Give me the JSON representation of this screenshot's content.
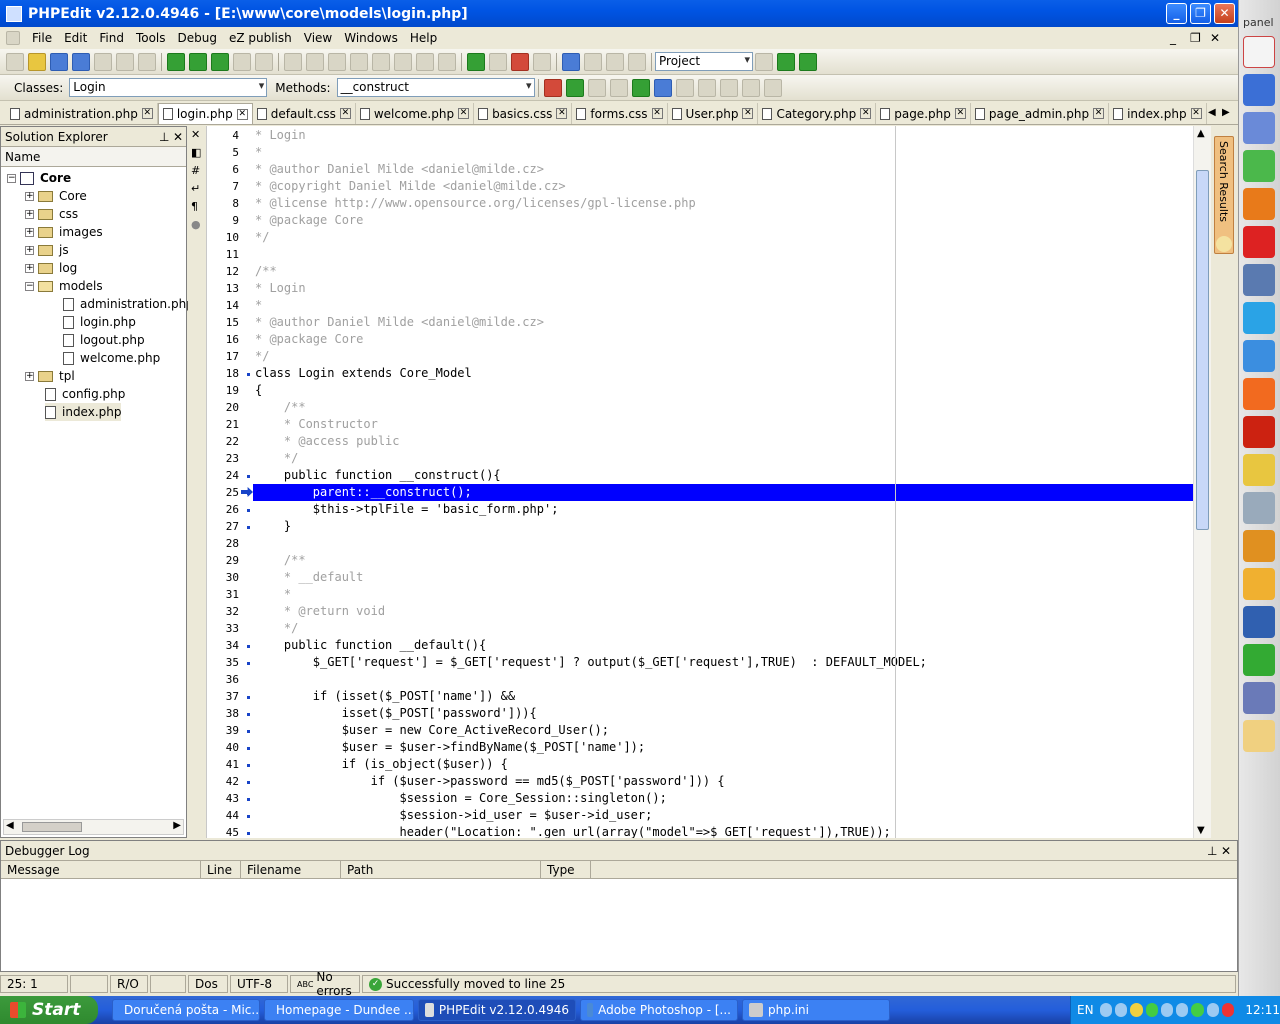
{
  "window": {
    "title": "PHPEdit v2.12.0.4946 - [E:\\www\\core\\models\\login.php]"
  },
  "menu": [
    "File",
    "Edit",
    "Find",
    "Tools",
    "Debug",
    "eZ publish",
    "View",
    "Windows",
    "Help"
  ],
  "toolbar": {
    "project_combo": "Project"
  },
  "toolbar2": {
    "classes_label": "Classes:",
    "classes_value": "Login",
    "methods_label": "Methods:",
    "methods_value": "__construct"
  },
  "tabs": [
    "administration.php",
    "login.php",
    "default.css",
    "welcome.php",
    "basics.css",
    "forms.css",
    "User.php",
    "Category.php",
    "page.php",
    "page_admin.php",
    "index.php"
  ],
  "solution": {
    "title": "Solution Explorer",
    "col": "Name",
    "root": "Core",
    "nodes": [
      {
        "label": "Core",
        "kind": "folder"
      },
      {
        "label": "css",
        "kind": "folder"
      },
      {
        "label": "images",
        "kind": "folder"
      },
      {
        "label": "js",
        "kind": "folder"
      },
      {
        "label": "log",
        "kind": "folder"
      },
      {
        "label": "models",
        "kind": "folder-open"
      },
      {
        "label": "administration.php",
        "kind": "file"
      },
      {
        "label": "login.php",
        "kind": "file"
      },
      {
        "label": "logout.php",
        "kind": "file"
      },
      {
        "label": "welcome.php",
        "kind": "file"
      },
      {
        "label": "tpl",
        "kind": "folder"
      },
      {
        "label": "config.php",
        "kind": "file"
      },
      {
        "label": "index.php",
        "kind": "file"
      }
    ]
  },
  "code": {
    "lines": [
      {
        "n": "4",
        "t": "* Login",
        "c": "comment"
      },
      {
        "n": "5",
        "t": "*",
        "c": "comment"
      },
      {
        "n": "6",
        "t": "* @author Daniel Milde <daniel@milde.cz>",
        "c": "comment"
      },
      {
        "n": "7",
        "t": "* @copyright Daniel Milde <daniel@milde.cz>",
        "c": "comment"
      },
      {
        "n": "8",
        "t": "* @license http://www.opensource.org/licenses/gpl-license.php",
        "c": "comment"
      },
      {
        "n": "9",
        "t": "* @package Core",
        "c": "comment"
      },
      {
        "n": "10",
        "t": "*/",
        "c": "comment"
      },
      {
        "n": "11",
        "t": "",
        "c": ""
      },
      {
        "n": "12",
        "t": "/**",
        "c": "comment"
      },
      {
        "n": "13",
        "t": "* Login",
        "c": "comment"
      },
      {
        "n": "14",
        "t": "*",
        "c": "comment"
      },
      {
        "n": "15",
        "t": "* @author Daniel Milde <daniel@milde.cz>",
        "c": "comment"
      },
      {
        "n": "16",
        "t": "* @package Core",
        "c": "comment"
      },
      {
        "n": "17",
        "t": "*/",
        "c": "comment"
      },
      {
        "n": "18",
        "t": "class Login extends Core_Model",
        "c": "kw"
      },
      {
        "n": "19",
        "t": "{",
        "c": ""
      },
      {
        "n": "20",
        "t": "    /**",
        "c": "comment"
      },
      {
        "n": "21",
        "t": "    * Constructor",
        "c": "comment"
      },
      {
        "n": "22",
        "t": "    * @access public",
        "c": "comment"
      },
      {
        "n": "23",
        "t": "    */",
        "c": "comment"
      },
      {
        "n": "24",
        "t": "    public function __construct(){",
        "c": "kw"
      },
      {
        "n": "25",
        "t": "        parent::__construct();",
        "c": "hl"
      },
      {
        "n": "26",
        "t": "        $this->tplFile = 'basic_form.php';",
        "c": "var"
      },
      {
        "n": "27",
        "t": "    }",
        "c": ""
      },
      {
        "n": "28",
        "t": "",
        "c": ""
      },
      {
        "n": "29",
        "t": "    /**",
        "c": "comment"
      },
      {
        "n": "30",
        "t": "    * __default",
        "c": "comment"
      },
      {
        "n": "31",
        "t": "    *",
        "c": "comment"
      },
      {
        "n": "32",
        "t": "    * @return void",
        "c": "comment"
      },
      {
        "n": "33",
        "t": "    */",
        "c": "comment"
      },
      {
        "n": "34",
        "t": "    public function __default(){",
        "c": "kw"
      },
      {
        "n": "35",
        "t": "        $_GET['request'] = $_GET['request'] ? output($_GET['request'],TRUE)  : DEFAULT_MODEL;",
        "c": "var"
      },
      {
        "n": "36",
        "t": "",
        "c": ""
      },
      {
        "n": "37",
        "t": "        if (isset($_POST['name']) &&",
        "c": "var"
      },
      {
        "n": "38",
        "t": "            isset($_POST['password'])){",
        "c": "var"
      },
      {
        "n": "39",
        "t": "            $user = new Core_ActiveRecord_User();",
        "c": "var"
      },
      {
        "n": "40",
        "t": "            $user = $user->findByName($_POST['name']);",
        "c": "var"
      },
      {
        "n": "41",
        "t": "            if (is_object($user)) {",
        "c": "var"
      },
      {
        "n": "42",
        "t": "                if ($user->password == md5($_POST['password'])) {",
        "c": "var"
      },
      {
        "n": "43",
        "t": "                    $session = Core_Session::singleton();",
        "c": "var"
      },
      {
        "n": "44",
        "t": "                    $session->id_user = $user->id_user;",
        "c": "var"
      },
      {
        "n": "45",
        "t": "                    header(\"Location: \".gen_url(array(\"model\"=>$_GET['request']),TRUE));",
        "c": "var"
      }
    ]
  },
  "side_tab": "Search Results",
  "debugger": {
    "title": "Debugger Log",
    "cols": [
      "Message",
      "Line",
      "Filename",
      "Path",
      "Type"
    ]
  },
  "status": {
    "position": "25:   1",
    "ro": "R/O",
    "mode": "Dos",
    "encoding": "UTF-8",
    "errors": "No errors",
    "message": "Successfully moved to line 25"
  },
  "taskbar": {
    "start": "Start",
    "items": [
      "Doručená pošta - Mic...",
      "Homepage - Dundee ...",
      "PHPEdit v2.12.0.4946",
      "Adobe Photoshop - [...",
      "php.ini"
    ],
    "lang": "EN",
    "clock": "12:11"
  },
  "sidepanel": {
    "label": "panel"
  }
}
